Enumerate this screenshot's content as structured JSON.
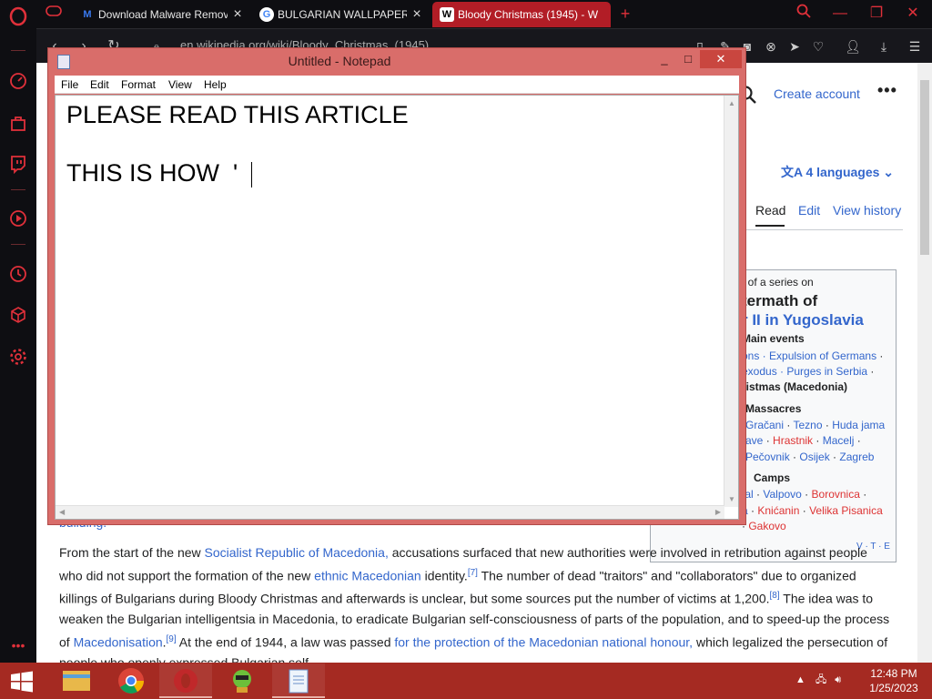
{
  "browser": {
    "tabs": [
      {
        "label": "Download Malware Remov",
        "favicon": "M"
      },
      {
        "label": "BULGARIAN WALLPAPERS -",
        "favicon": "G"
      },
      {
        "label": "Bloody Christmas (1945) - W",
        "favicon": "W"
      }
    ],
    "new_tab": "+",
    "url": "en.wikipedia.org/wiki/Bloody_Christmas_(1945)"
  },
  "wiki": {
    "create_account": "Create account",
    "more": "•••",
    "languages": "4 languages",
    "tabs": {
      "read": "Read",
      "edit": "Edit",
      "history": "View history"
    },
    "infobox": {
      "series_intro": "t of a series on",
      "title_1": "termath of",
      "title_2": "r II in Yugoslavia",
      "main_events": "Main events",
      "line_1a": "ons · ",
      "line_1b": "Expulsion of Germans",
      "line_1c": " ·",
      "line_2a": " exodus · ",
      "line_2b": "Purges in Serbia",
      "line_2c": " ·",
      "line_3": "ristmas (Macedonia)",
      "massacres": "Massacres",
      "m1a": "Gračani",
      "m1b": "Tezno",
      "m1c": "Huda jama",
      "m2a": "ave",
      "m2b": "Hrastnik",
      "m2c": "Macelj",
      "m3a": "Pečovnik",
      "m3b": "Osijek",
      "m3c": "Zagreb",
      "camps": "Camps",
      "c1a": "tal",
      "c1b": "Valpovo",
      "c1c": "Borovnica",
      "c2a": "a",
      "c2b": "Knićanin",
      "c2c": "Velika Pisanica",
      "c3": "Gakovo",
      "vte": "V · T · E"
    },
    "prev_text": "building.",
    "paragraph": {
      "p1": "From the start of the new ",
      "l1": "Socialist Republic of Macedonia,",
      "p2": " accusations surfaced that new authorities were involved in retribution against people who did not support the formation of the new ",
      "l2": "ethnic Macedonian",
      "p3": " identity.",
      "r7": "[7]",
      "p4": " The number of dead \"traitors\" and \"collaborators\" due to organized killings of Bulgarians during Bloody Christmas and afterwards is unclear, but some sources put the number of victims at 1,200.",
      "r8": "[8]",
      "p5": " The idea was to weaken the Bulgarian intelligentsia in Macedonia, to eradicate Bulgarian self-consciousness of parts of the population, and to speed-up the process of ",
      "l3": "Macedonisation",
      "p6": ".",
      "r9": "[9]",
      "p7": " At the end of 1944, a law was passed ",
      "l4": "for the protection of the Macedonian national honour,",
      "p8": " which legalized the persecution of people who openly expressed Bulgarian self-"
    }
  },
  "notepad": {
    "title": "Untitled - Notepad",
    "menu": [
      "File",
      "Edit",
      "Format",
      "View",
      "Help"
    ],
    "line1": "PLEASE READ THIS ARTICLE",
    "line2": "THIS IS HOW  '"
  },
  "taskbar": {
    "time": "12:48 PM",
    "date": "1/25/2023"
  },
  "colors": {
    "opera_red": "#e0303a",
    "tab_active": "#b21d26",
    "taskbar": "#a52a22",
    "notepad_frame": "#d96d6a",
    "wiki_link": "#3366cc"
  }
}
